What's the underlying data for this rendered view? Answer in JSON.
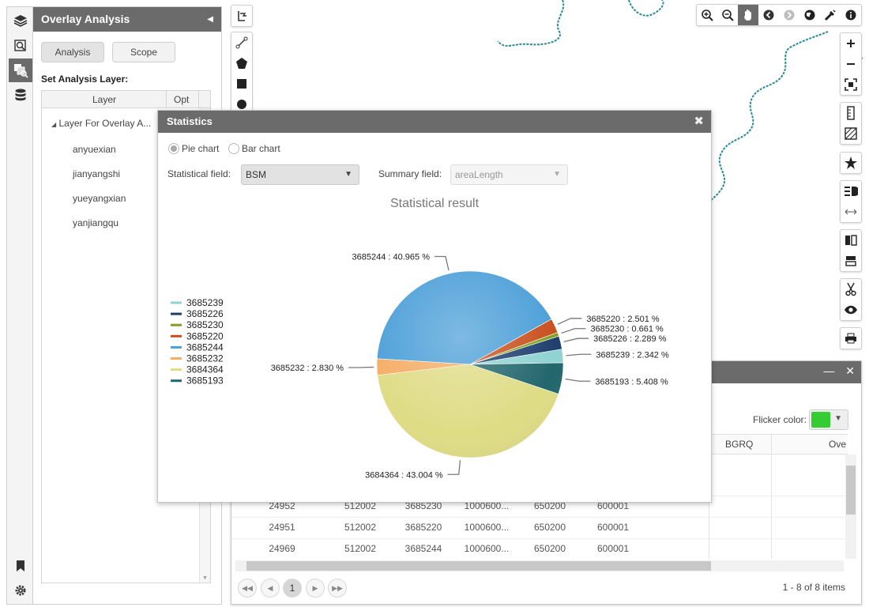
{
  "colors": {
    "header_bg": "#6b6b6b",
    "river": "#2a8a96",
    "flicker": "#33cc33"
  },
  "rail": {
    "icons": [
      "layers-icon",
      "search-map-icon",
      "overlay-analysis-icon",
      "database-icon",
      "bookmark-icon",
      "gear-icon"
    ]
  },
  "panel": {
    "title": "Overlay Analysis",
    "tabs": [
      {
        "label": "Analysis"
      },
      {
        "label": "Scope"
      }
    ],
    "set_label": "Set Analysis Layer:",
    "grid_headers": {
      "layer": "Layer",
      "opt": "Opt"
    },
    "tree_root": "Layer For Overlay A...",
    "tree_items": [
      "anyuexian",
      "jianyangshi",
      "yueyangxian",
      "yanjiangqu"
    ]
  },
  "map_toolbar": {
    "top_tools": [
      "zoom-in-icon",
      "zoom-out-icon",
      "pan-hand-icon",
      "back-icon",
      "forward-icon",
      "globe-icon",
      "measure-icon",
      "info-icon"
    ],
    "side_groups": [
      [
        "plus-icon",
        "minus-icon",
        "full-extent-icon"
      ],
      [
        "ruler-icon",
        "area-icon"
      ],
      [
        "favorite-icon"
      ],
      [
        "legend-icon",
        "swipe-icon"
      ],
      [
        "split-icon",
        "print-layout-icon"
      ],
      [
        "scissors-icon",
        "eye-icon"
      ],
      [
        "printer-icon"
      ]
    ],
    "draw_tools": [
      "draw-line-icon",
      "draw-polygon-icon",
      "draw-rectangle-icon",
      "draw-circle-icon"
    ]
  },
  "result": {
    "flicker_label": "Flicker color:",
    "columns_visible": [
      "BGRQ",
      "Ove"
    ],
    "rows": [
      [
        "24952",
        "512002",
        "3685230",
        "1000600...",
        "650200",
        "600001"
      ],
      [
        "24951",
        "512002",
        "3685220",
        "1000600...",
        "650200",
        "600001"
      ],
      [
        "24969",
        "512002",
        "3685244",
        "1000600...",
        "650200",
        "600001"
      ]
    ],
    "current_page": "1",
    "pager_info": "1 - 8 of 8 items"
  },
  "stats": {
    "title": "Statistics",
    "chart_types": [
      {
        "label": "Pie chart",
        "selected": true
      },
      {
        "label": "Bar chart",
        "selected": false
      }
    ],
    "statistical_field_label": "Statistical field:",
    "statistical_field_value": "BSM",
    "summary_field_label": "Summary field:",
    "summary_field_value": "areaLength"
  },
  "chart_data": {
    "type": "pie",
    "title": "Statistical result",
    "legend_position": "left",
    "slices": [
      {
        "name": "3685239",
        "value": 2.342,
        "color": "#8fd3d2",
        "label": "3685239 : 2.342 %"
      },
      {
        "name": "3685226",
        "value": 2.289,
        "color": "#1f3f6e",
        "label": "3685226 : 2.289 %"
      },
      {
        "name": "3685230",
        "value": 0.661,
        "color": "#7fa022",
        "label": "3685230 : 0.661 %"
      },
      {
        "name": "3685220",
        "value": 2.501,
        "color": "#c8501c",
        "label": "3685220 : 2.501 %"
      },
      {
        "name": "3685244",
        "value": 40.965,
        "color": "#4c9fd8",
        "label": "3685244 : 40.965 %"
      },
      {
        "name": "3685232",
        "value": 2.83,
        "color": "#f5ad66",
        "label": "3685232 : 2.830 %"
      },
      {
        "name": "3684364",
        "value": 43.004,
        "color": "#dfdc86",
        "label": "3684364 : 43.004 %"
      },
      {
        "name": "3685193",
        "value": 5.408,
        "color": "#22676d",
        "label": "3685193 : 5.408 %"
      }
    ]
  }
}
